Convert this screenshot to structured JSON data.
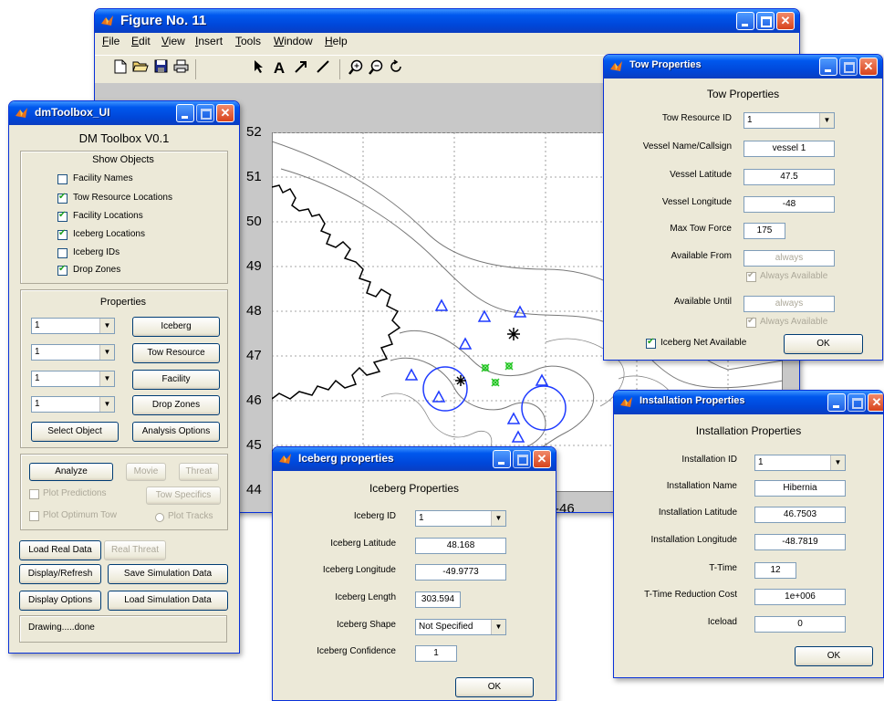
{
  "figure": {
    "title": "Figure No. 11",
    "menu": [
      "File",
      "Edit",
      "View",
      "Insert",
      "Tools",
      "Window",
      "Help"
    ],
    "menu_underline": [
      "F",
      "E",
      "V",
      "I",
      "T",
      "W",
      "H"
    ],
    "toolbar_icons": [
      "new-file-icon",
      "open-folder-icon",
      "save-icon",
      "print-icon",
      "pointer-arrow-icon",
      "text-tool-icon",
      "arrow-tool-icon",
      "line-tool-icon",
      "zoom-in-icon",
      "zoom-out-icon",
      "rotate-icon"
    ],
    "axes": {
      "y_ticks": [
        "52",
        "51",
        "50",
        "49",
        "48",
        "47",
        "46",
        "45",
        "44"
      ],
      "x_ticks_visible": [
        "-46"
      ]
    }
  },
  "toolbox": {
    "title": "dmToolbox_UI",
    "heading": "DM Toolbox V0.1",
    "show_objects": {
      "title": "Show Objects",
      "items": [
        {
          "label": "Facility Names",
          "checked": false
        },
        {
          "label": "Tow Resource Locations",
          "checked": true
        },
        {
          "label": "Facility Locations",
          "checked": true
        },
        {
          "label": "Iceberg Locations",
          "checked": true
        },
        {
          "label": "Iceberg IDs",
          "checked": false
        },
        {
          "label": "Drop Zones",
          "checked": true
        }
      ]
    },
    "properties": {
      "title": "Properties",
      "rows": [
        {
          "select": "1",
          "button": "Iceberg"
        },
        {
          "select": "1",
          "button": "Tow Resource"
        },
        {
          "select": "1",
          "button": "Facility"
        },
        {
          "select": "1",
          "button": "Drop Zones"
        }
      ],
      "select_object": "Select Object",
      "analysis_options": "Analysis Options"
    },
    "analysis": {
      "analyze": "Analyze",
      "movie": "Movie",
      "threat": "Threat",
      "plot_predictions": "Plot Predictions",
      "tow_specifics": "Tow Specifics",
      "plot_optimum_tow": "Plot Optimum Tow",
      "plot_tracks": "Plot Tracks"
    },
    "bottom": {
      "load_real_data": "Load Real Data",
      "real_threat": "Real Threat",
      "display_refresh": "Display/Refresh",
      "save_simulation_data": "Save Simulation Data",
      "display_options": "Display Options",
      "load_simulation_data": "Load Simulation Data"
    },
    "status": "Drawing.....done"
  },
  "tow": {
    "title": "Tow Properties",
    "heading": "Tow Properties",
    "tow_resource_id_label": "Tow Resource ID",
    "tow_resource_id": "1",
    "vessel_name_label": "Vessel Name/Callsign",
    "vessel_name": "vessel 1",
    "vessel_lat_label": "Vessel Latitude",
    "vessel_lat": "47.5",
    "vessel_lon_label": "Vessel Longitude",
    "vessel_lon": "-48",
    "max_tow_force_label": "Max Tow Force",
    "max_tow_force": "175",
    "available_from_label": "Available From",
    "available_from": "always",
    "always_available_label": "Always Available",
    "available_until_label": "Available Until",
    "available_until": "always",
    "iceberg_net_label": "Iceberg Net Available",
    "ok": "OK"
  },
  "installation": {
    "title": "Installation Properties",
    "heading": "Installation Properties",
    "id_label": "Installation ID",
    "id": "1",
    "name_label": "Installation Name",
    "name": "Hibernia",
    "lat_label": "Installation Latitude",
    "lat": "46.7503",
    "lon_label": "Installation Longitude",
    "lon": "-48.7819",
    "ttime_label": "T-Time",
    "ttime": "12",
    "ttime_cost_label": "T-Time Reduction Cost",
    "ttime_cost": "1e+006",
    "iceload_label": "Iceload",
    "iceload": "0",
    "ok": "OK"
  },
  "iceberg": {
    "title": "Iceberg properties",
    "heading": "Iceberg Properties",
    "id_label": "Iceberg ID",
    "id": "1",
    "lat_label": "Iceberg Latitude",
    "lat": "48.168",
    "lon_label": "Iceberg Longitude",
    "lon": "-49.9773",
    "length_label": "Iceberg Length",
    "length": "303.594",
    "shape_label": "Iceberg Shape",
    "shape": "Not Specified",
    "confidence_label": "Iceberg Confidence",
    "confidence": "1",
    "ok": "OK"
  }
}
